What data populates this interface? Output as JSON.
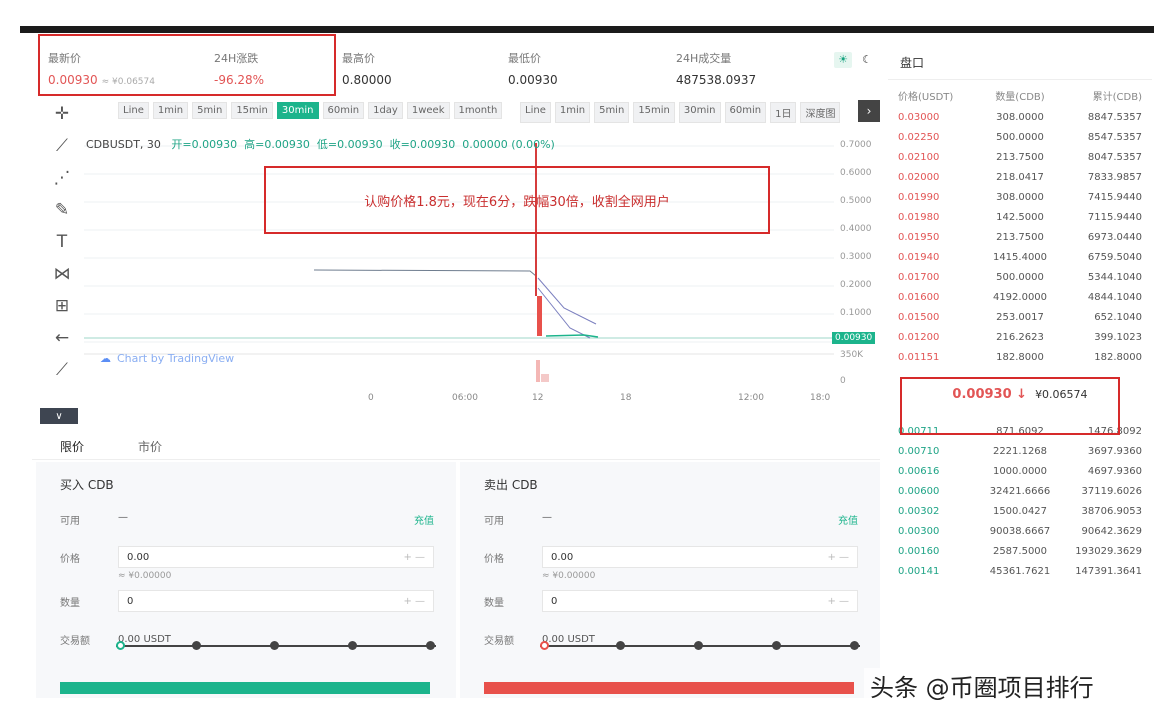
{
  "ticker": [
    {
      "label": "最新价",
      "value": "0.00930",
      "sub": "≈ ¥0.06574",
      "color": "red"
    },
    {
      "label": "24H涨跌",
      "value": "-96.28%",
      "sub": "",
      "color": "red"
    },
    {
      "label": "最高价",
      "value": "0.80000",
      "sub": "",
      "color": ""
    },
    {
      "label": "最低价",
      "value": "0.00930",
      "sub": "",
      "color": ""
    },
    {
      "label": "24H成交量",
      "value": "487538.0937",
      "sub": "",
      "color": ""
    }
  ],
  "theme_icons": {
    "light": "☀",
    "dark": "☾"
  },
  "toolbar": [
    {
      "name": "crosshair-icon",
      "glyph": "✛"
    },
    {
      "name": "trendline-icon",
      "glyph": "⟋"
    },
    {
      "name": "fib-icon",
      "glyph": "⋰"
    },
    {
      "name": "brush-icon",
      "glyph": "✎"
    },
    {
      "name": "text-tool-icon",
      "glyph": "T"
    },
    {
      "name": "pattern-icon",
      "glyph": "⋈"
    },
    {
      "name": "measure-icon",
      "glyph": "⊞"
    },
    {
      "name": "back-arrow-icon",
      "glyph": "←"
    },
    {
      "name": "ruler-icon",
      "glyph": "⟋"
    }
  ],
  "collapse_glyph": "∨",
  "intervals_left": [
    "Line",
    "1min",
    "5min",
    "15min",
    "30min",
    "60min",
    "1day",
    "1week",
    "1month"
  ],
  "intervals_left_active": 4,
  "intervals_right": [
    "Line",
    "1min",
    "5min",
    "15min",
    "30min",
    "60min",
    "1日",
    "深度图"
  ],
  "nav_glyph": "›",
  "legend": {
    "symbol": "CDBUSDT, 30",
    "o": "开=0.00930",
    "h": "高=0.00930",
    "l": "低=0.00930",
    "c": "收=0.00930",
    "chg": "0.00000 (0.00%)"
  },
  "annotation": "认购价格1.8元，现在6分，跌幅30倍，收割全网用户",
  "watermark": "Chart by TradingView",
  "y_ticks": [
    "0.7000",
    "0.6000",
    "0.5000",
    "0.4000",
    "0.3000",
    "0.2000",
    "0.1000",
    "350K",
    "0"
  ],
  "last_price_tag": "0.00930",
  "x_ticks": [
    "0",
    "06:00",
    "12",
    "18",
    "12:00",
    "18:0"
  ],
  "order_tabs": [
    "限价",
    "市价"
  ],
  "buy": {
    "title": "买入 CDB",
    "avail_label": "可用",
    "avail_value": "—",
    "deposit_link": "充值",
    "price_label": "价格",
    "price_value": "0.00",
    "price_hint": "≈ ¥0.00000",
    "qty_label": "数量",
    "qty_value": "0",
    "total_label": "交易额",
    "total_value": "0.00 USDT"
  },
  "sell": {
    "title": "卖出 CDB",
    "avail_label": "可用",
    "avail_value": "—",
    "deposit_link": "充值",
    "price_label": "价格",
    "price_value": "0.00",
    "price_hint": "≈ ¥0.00000",
    "qty_label": "数量",
    "qty_value": "0",
    "total_label": "交易额",
    "total_value": "0.00 USDT"
  },
  "colors": {
    "buy": "#1cb48c",
    "sell": "#e8514b",
    "annotation_box": "#d62a2a"
  },
  "orderbook": {
    "title": "盘口",
    "headers": [
      "价格(USDT)",
      "数量(CDB)",
      "累计(CDB)"
    ],
    "asks": [
      [
        "0.03000",
        "308.0000",
        "8847.5357"
      ],
      [
        "0.02250",
        "500.0000",
        "8547.5357"
      ],
      [
        "0.02100",
        "213.7500",
        "8047.5357"
      ],
      [
        "0.02000",
        "218.0417",
        "7833.9857"
      ],
      [
        "0.01990",
        "308.0000",
        "7415.9440"
      ],
      [
        "0.01980",
        "142.5000",
        "7115.9440"
      ],
      [
        "0.01950",
        "213.7500",
        "6973.0440"
      ],
      [
        "0.01940",
        "1415.4000",
        "6759.5040"
      ],
      [
        "0.01700",
        "500.0000",
        "5344.1040"
      ],
      [
        "0.01600",
        "4192.0000",
        "4844.1040"
      ],
      [
        "0.01500",
        "253.0017",
        "652.1040"
      ],
      [
        "0.01200",
        "216.2623",
        "399.1023"
      ],
      [
        "0.01151",
        "182.8000",
        "182.8000"
      ]
    ],
    "mid_price": "0.00930 ↓",
    "mid_cny": "¥0.06574",
    "bids": [
      [
        "0.00711",
        "871.6092",
        "1476.8092"
      ],
      [
        "0.00710",
        "2221.1268",
        "3697.9360"
      ],
      [
        "0.00616",
        "1000.0000",
        "4697.9360"
      ],
      [
        "0.00600",
        "32421.6666",
        "37119.6026"
      ],
      [
        "0.00302",
        "1500.0427",
        "38706.9053"
      ],
      [
        "0.00300",
        "90038.6667",
        "90642.3629"
      ],
      [
        "0.00160",
        "2587.5000",
        "193029.3629"
      ],
      [
        "0.00141",
        "45361.7621",
        "147391.3641"
      ]
    ]
  },
  "footer": "头条 @币圈项目排行"
}
